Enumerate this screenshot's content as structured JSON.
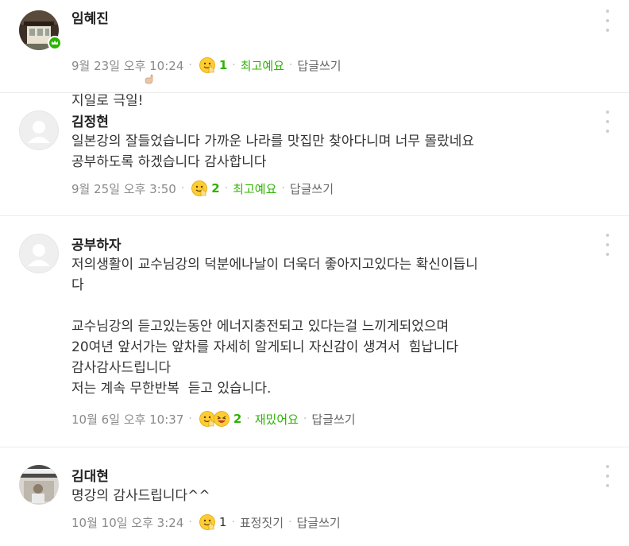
{
  "comments": [
    {
      "author": "임혜진",
      "body": "지일로 극일!",
      "date": "9월 23일 오후 10:24",
      "reaction_count": "1",
      "reaction_label": "최고예요",
      "reply_label": "답글쓰기",
      "avatar": "photo",
      "badge": "crown-badge"
    },
    {
      "author": "김정현",
      "body": "일본강의 잘들었습니다 가까운 나라를 맛집만 찾아다니며 너무 몰랐네요\n공부하도록 하겠습니다 감사합니다",
      "date": "9월 25일 오후 3:50",
      "reaction_count": "2",
      "reaction_label": "최고예요",
      "reply_label": "답글쓰기",
      "avatar": "default"
    },
    {
      "author": "공부하자",
      "body": "저의생활이 교수님강의 덕분에나날이 더욱더 좋아지고있다는 확신이듭니\n다\n\n교수님강의 듣고있는동안 에너지충전되고 있다는걸 느끼게되었으며\n20여년 앞서가는 앞차를 자세히 알게되니 자신감이 생겨서  힘납니다\n감사감사드립니다\n저는 계속 무한반복  듣고 있습니다.",
      "date": "10월 6일 오후 10:37",
      "reaction_count": "2",
      "reaction_label": "재밌어요",
      "reply_label": "답글쓰기",
      "avatar": "default"
    },
    {
      "author": "김대현",
      "body": "명강의 감사드립니다^^",
      "date": "10월 10일 오후 3:24",
      "reaction_count": "1",
      "reaction_label": "표정짓기",
      "reply_label": "답글쓰기",
      "avatar": "photo"
    }
  ],
  "colors": {
    "accent": "#2db400",
    "meta": "#8a8a8a",
    "separator": "#ececec"
  },
  "icons": {
    "more": "more-vertical-icon",
    "reaction": "smile-emoji-icon",
    "reaction_fun": "laugh-emoji-icon",
    "thumb": "thumb-up-emoji-icon"
  }
}
